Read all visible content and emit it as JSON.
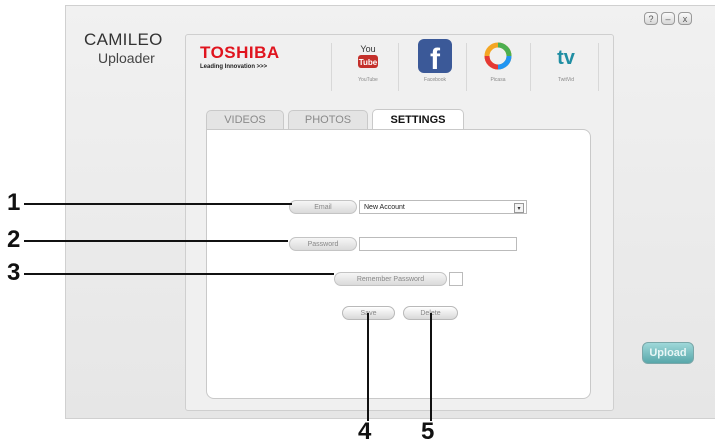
{
  "app": {
    "title": "CAMILEO",
    "subtitle": "Uploader"
  },
  "window_controls": [
    {
      "name": "help-button",
      "glyph": "?"
    },
    {
      "name": "minimize-button",
      "glyph": "–"
    },
    {
      "name": "close-button",
      "glyph": "x"
    }
  ],
  "brand": {
    "name": "TOSHIBA",
    "tagline": "Leading Innovation >>>"
  },
  "services": [
    {
      "label": "YouTube",
      "icon": "youtube-icon",
      "color": "#c4302b",
      "active": false
    },
    {
      "label": "Facebook",
      "icon": "facebook-icon",
      "color": "#3b5998",
      "active": true
    },
    {
      "label": "Picasa",
      "icon": "picasa-icon",
      "color": "#f4a623",
      "active": false
    },
    {
      "label": "TwitVid",
      "icon": "twitvid-icon",
      "color": "#1f8ea3",
      "active": false
    }
  ],
  "tabs": [
    {
      "label": "VIDEOS",
      "active": false
    },
    {
      "label": "PHOTOS",
      "active": false
    },
    {
      "label": "SETTINGS",
      "active": true
    }
  ],
  "settings": {
    "email_label": "Email",
    "email_value": "New Account",
    "password_label": "Password",
    "password_value": "",
    "remember_label": "Remember Password",
    "remember_checked": false,
    "save_label": "Save",
    "delete_label": "Delete"
  },
  "upload_label": "Upload",
  "callouts": [
    "1",
    "2",
    "3",
    "4",
    "5"
  ]
}
